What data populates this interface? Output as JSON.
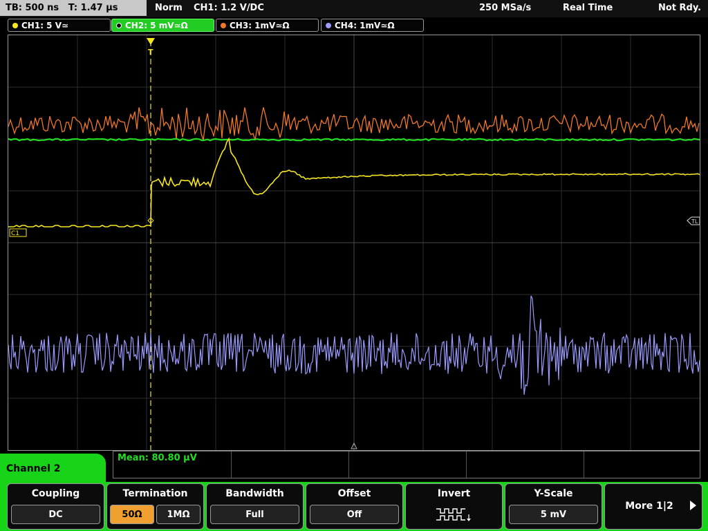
{
  "header": {
    "timebase": "TB: 500 ns",
    "trigger_time": "T: 1.47 µs",
    "mode": "Norm",
    "trigger_src": "CH1: 1.2 V",
    "trigger_slope": "/DC",
    "sample_rate": "250 MSa/s",
    "acq_mode": "Real Time",
    "status": "Not Rdy."
  },
  "channels": [
    {
      "label": "CH1: 5 V≃",
      "color": "#f5e620",
      "active": false
    },
    {
      "label": "CH2: 5 mV≃Ω",
      "color": "#22dd22",
      "active": true
    },
    {
      "label": "CH3: 1mV≃Ω",
      "color": "#f07828",
      "active": false
    },
    {
      "label": "CH4: 1mV≃Ω",
      "color": "#9a9aff",
      "active": false
    }
  ],
  "markers": {
    "ch1": "C1",
    "trigger_level": "TL",
    "trigger_top": "T"
  },
  "measurement": {
    "mean": "Mean: 80.80 µV"
  },
  "panel": {
    "title": "Channel 2",
    "coupling": {
      "label": "Coupling",
      "value": "DC"
    },
    "termination": {
      "label": "Termination",
      "opt1": "50Ω",
      "opt2": "1MΩ"
    },
    "bandwidth": {
      "label": "Bandwidth",
      "value": "Full"
    },
    "offset": {
      "label": "Offset",
      "value": "Off"
    },
    "invert": {
      "label": "Invert"
    },
    "yscale": {
      "label": "Y-Scale",
      "value": "5 mV"
    },
    "more": {
      "label": "More 1|2"
    }
  },
  "colors": {
    "ch1": "#f5e620",
    "ch2": "#22dd22",
    "ch3": "#f07828",
    "ch4": "#9a9aff",
    "menu": "#18d418",
    "selected": "#f0a030"
  }
}
